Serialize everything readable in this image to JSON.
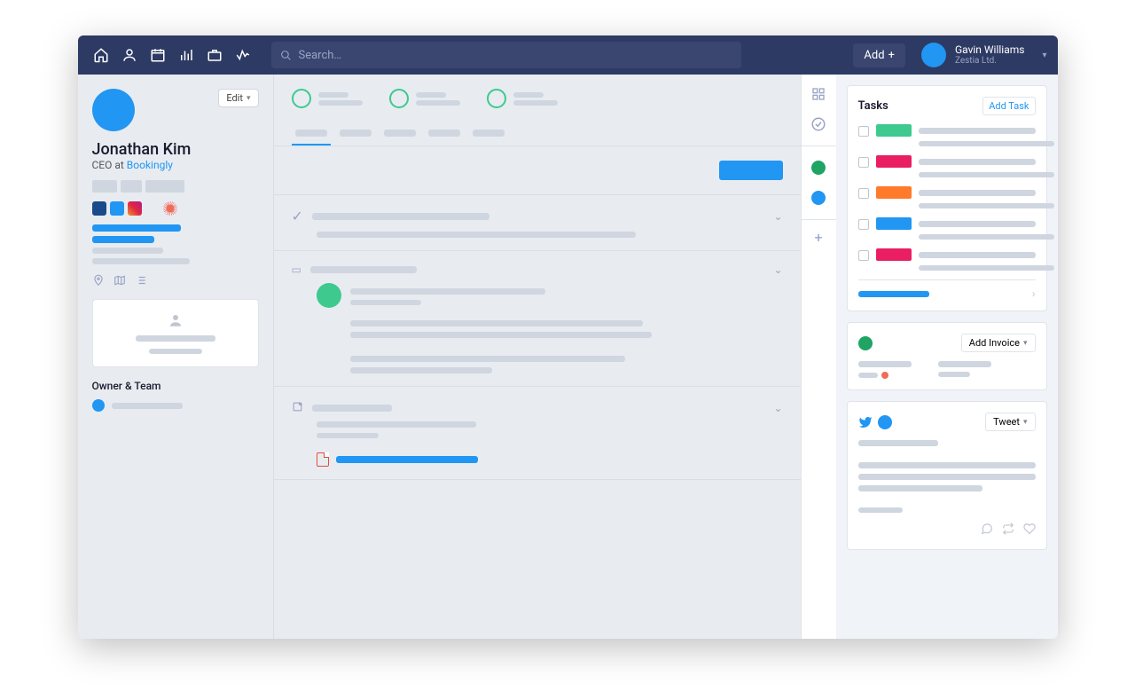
{
  "search": {
    "placeholder": "Search…"
  },
  "add_button": "Add",
  "user": {
    "name": "Gavin Williams",
    "org": "Zestia Ltd."
  },
  "profile": {
    "name": "Jonathan Kim",
    "role_prefix": "CEO at ",
    "company": "Bookingly",
    "edit": "Edit"
  },
  "owner_team": {
    "title": "Owner & Team"
  },
  "tasks_panel": {
    "title": "Tasks",
    "add": "Add Task"
  },
  "tasks": [
    {
      "color": "#3ec98f"
    },
    {
      "color": "#e91e63"
    },
    {
      "color": "#ff7a2b"
    },
    {
      "color": "#2196f3"
    },
    {
      "color": "#e91e63"
    }
  ],
  "invoice_panel": {
    "add": "Add Invoice"
  },
  "tweet_panel": {
    "action": "Tweet"
  },
  "colors": {
    "blue": "#2196f3",
    "green": "#3ec98f",
    "darkgreen": "#1fa463",
    "pink": "#e91e63",
    "orange": "#ff7a2b",
    "coral": "#f06c5a",
    "grey": "#d0d6e0",
    "insta": "linear-gradient(45deg,#f09433,#e6683c,#dc2743,#cc2366,#bc1888)"
  },
  "nav_icons": [
    "home",
    "person",
    "calendar",
    "chart",
    "briefcase",
    "activity"
  ],
  "rail": {
    "grid": "grid-icon",
    "check": "check-icon",
    "green": "#1fa463",
    "blue": "#2196f3"
  }
}
